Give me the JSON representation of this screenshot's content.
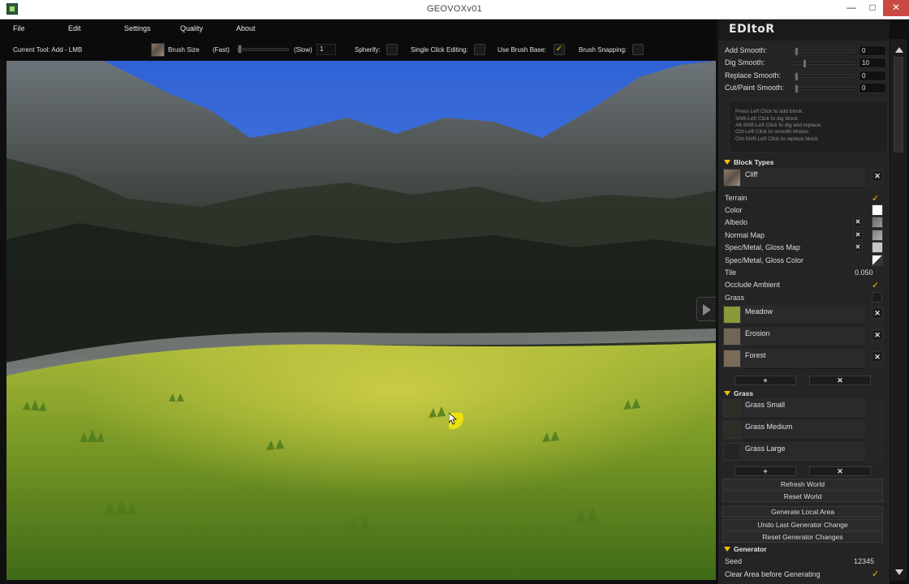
{
  "window": {
    "title": "GEOVOXv01",
    "minimize": "—",
    "maximize": "□",
    "close": "✕"
  },
  "menu": [
    "File",
    "Edit",
    "Settings",
    "Quality",
    "About"
  ],
  "toolbar": {
    "current_tool": "Current Tool: Add - LMB",
    "brush_size_label": "Brush Size",
    "fast_label": "(Fast)",
    "slow_label": "(Slow)",
    "brush_value": "1",
    "brush_speed_level": 0.0,
    "spherify_label": "Spherify:",
    "spherify_checked": false,
    "single_click_label": "Single Click Editing:",
    "single_click_checked": false,
    "brush_base_label": "Use Brush Base:",
    "brush_base_checked": true,
    "snapping_label": "Brush Snapping:",
    "snapping_checked": false,
    "check_glyph": "✓"
  },
  "editor": {
    "title": "EDItoR",
    "smooth": [
      {
        "label": "Add Smooth:",
        "value": "0",
        "level": 0.0
      },
      {
        "label": "Dig Smooth:",
        "value": "10",
        "level": 0.14
      },
      {
        "label": "Replace Smooth:",
        "value": "0",
        "level": 0.0
      },
      {
        "label": "Cut/Paint Smooth:",
        "value": "0",
        "level": 0.0
      }
    ],
    "help": [
      "Press Left Click to add block.",
      "Shift-Left Click to dig block.",
      "Alt-Shift-Left Click to dig and replace.",
      "Ctrl-Left Click to smooth blocks.",
      "Ctrl-Shift-Left Click to replace block."
    ],
    "block_types_header": "Block Types",
    "selected_block": "Cliff",
    "props": {
      "terrain": "Terrain",
      "color": "Color",
      "albedo": "Albedo",
      "normal_map": "Normal Map",
      "spec_map": "Spec/Metal, Gloss Map",
      "spec_color": "Spec/Metal, Gloss Color",
      "tile": "Tile",
      "tile_value": "0.050",
      "occlude": "Occlude Ambient",
      "grass": "Grass"
    },
    "blocks": [
      {
        "name": "Meadow",
        "color": "#8a9a3a"
      },
      {
        "name": "Erosion",
        "color": "#6e6656"
      },
      {
        "name": "Forest",
        "color": "#7a6a58"
      }
    ],
    "grass_header": "Grass",
    "grasses": [
      "Grass Small",
      "Grass Medium",
      "Grass Large"
    ],
    "add_glyph": "+",
    "remove_glyph": "✕",
    "buttons": [
      "Refresh World",
      "Reset World",
      "Generate Local Area",
      "Undo Last Generator Change",
      "Reset Generator Changes"
    ],
    "generator_header": "Generator",
    "seed_label": "Seed",
    "seed_value": "12345",
    "clear_label": "Clear Area before Generating",
    "clear_checked": true,
    "colors": {
      "accent": "#f3c200",
      "panel_bg": "#242424",
      "toolbar_bg": "#0b0b0b"
    }
  }
}
